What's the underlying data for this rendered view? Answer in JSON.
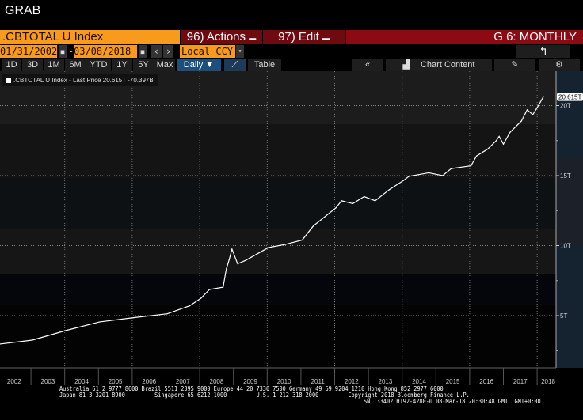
{
  "title": "GRAB",
  "toolbar": {
    "ticker": ".CBTOTAL U Index",
    "actions": "96) Actions",
    "edit": "97) Edit",
    "page": "G 6: MONTHLY",
    "start_date": "01/31/2002",
    "end_date": "03/08/2018",
    "date_sep": "-",
    "currency": "Local CCY",
    "ranges": [
      "1D",
      "3D",
      "1M",
      "6M",
      "YTD",
      "1Y",
      "5Y",
      "Max"
    ],
    "frequency": "Daily ▼",
    "table": "Table",
    "collapse": "«",
    "chart_content": "Chart Content"
  },
  "legend": {
    "text": ".CBTOTAL U Index - Last Price 20.615T  -70.397B"
  },
  "footer": {
    "line1": "Australia 61 2 9777 8600 Brazil 5511 2395 9000 Europe 44 20 7330 7500 Germany 49 69 9204 1210 Hong Kong 852 2977 6000",
    "line2": "Japan 81 3 3201 8900         Singapore 65 6212 1000         U.S. 1 212 318 2000         Copyright 2018 Bloomberg Finance L.P.",
    "line3": "SN 133402 H192-4280-0 08-Mar-18 20:30:48 GMT  GMT+0:00"
  },
  "colors": {
    "line": "#ffffff",
    "accent_orange": "#f89a1c",
    "header_red": "#8c0a14",
    "axis_panel": "#152330"
  },
  "chart_data": {
    "type": "line",
    "title": "",
    "series": [
      {
        "name": ".CBTOTAL U Index",
        "last_label": "20.615T",
        "points": [
          [
            "2002-01-31",
            2.97
          ],
          [
            "2003-01-15",
            3.25
          ],
          [
            "2004-01-15",
            3.94
          ],
          [
            "2005-01-15",
            4.55
          ],
          [
            "2006-01-15",
            4.85
          ],
          [
            "2007-01-15",
            5.13
          ],
          [
            "2007-09-15",
            5.7
          ],
          [
            "2008-01-15",
            6.24
          ],
          [
            "2008-04-15",
            6.86
          ],
          [
            "2008-09-10",
            7.03
          ],
          [
            "2008-10-15",
            8.33
          ],
          [
            "2008-11-15",
            9.0
          ],
          [
            "2008-12-15",
            9.75
          ],
          [
            "2009-02-15",
            8.7
          ],
          [
            "2009-05-15",
            8.95
          ],
          [
            "2010-01-15",
            9.86
          ],
          [
            "2010-07-15",
            10.08
          ],
          [
            "2011-01-15",
            10.4
          ],
          [
            "2011-05-15",
            11.4
          ],
          [
            "2012-01-15",
            12.7
          ],
          [
            "2012-03-15",
            13.2
          ],
          [
            "2012-07-15",
            13.0
          ],
          [
            "2012-11-15",
            13.5
          ],
          [
            "2013-03-15",
            13.2
          ],
          [
            "2013-08-15",
            14.0
          ],
          [
            "2014-01-15",
            14.65
          ],
          [
            "2014-03-15",
            14.95
          ],
          [
            "2014-10-15",
            15.2
          ],
          [
            "2015-03-15",
            15.0
          ],
          [
            "2015-06-15",
            15.5
          ],
          [
            "2016-01-15",
            15.7
          ],
          [
            "2016-03-15",
            16.4
          ],
          [
            "2016-07-15",
            16.9
          ],
          [
            "2016-10-15",
            17.5
          ],
          [
            "2016-11-15",
            17.8
          ],
          [
            "2017-01-01",
            17.25
          ],
          [
            "2017-03-15",
            18.1
          ],
          [
            "2017-07-15",
            18.9
          ],
          [
            "2017-09-15",
            19.7
          ],
          [
            "2017-11-15",
            19.35
          ],
          [
            "2018-01-15",
            20.0
          ],
          [
            "2018-03-08",
            20.615
          ]
        ]
      }
    ],
    "x_ticks": [
      "2002",
      "2003",
      "2004",
      "2005",
      "2006",
      "2007",
      "2008",
      "2009",
      "2010",
      "2011",
      "2012",
      "2013",
      "2014",
      "2015",
      "2016",
      "2017",
      "2018"
    ],
    "y_ticks": [
      {
        "v": 5,
        "label": "5T"
      },
      {
        "v": 10,
        "label": "10T"
      },
      {
        "v": 15,
        "label": "15T"
      },
      {
        "v": 20,
        "label": "20T"
      }
    ],
    "y_unit": "T",
    "ylim": [
      0,
      21.5
    ],
    "xlim": [
      "2002-01-01",
      "2018-03-31"
    ],
    "grid": true,
    "y_axis_side": "right",
    "legend_position": "top-left"
  }
}
